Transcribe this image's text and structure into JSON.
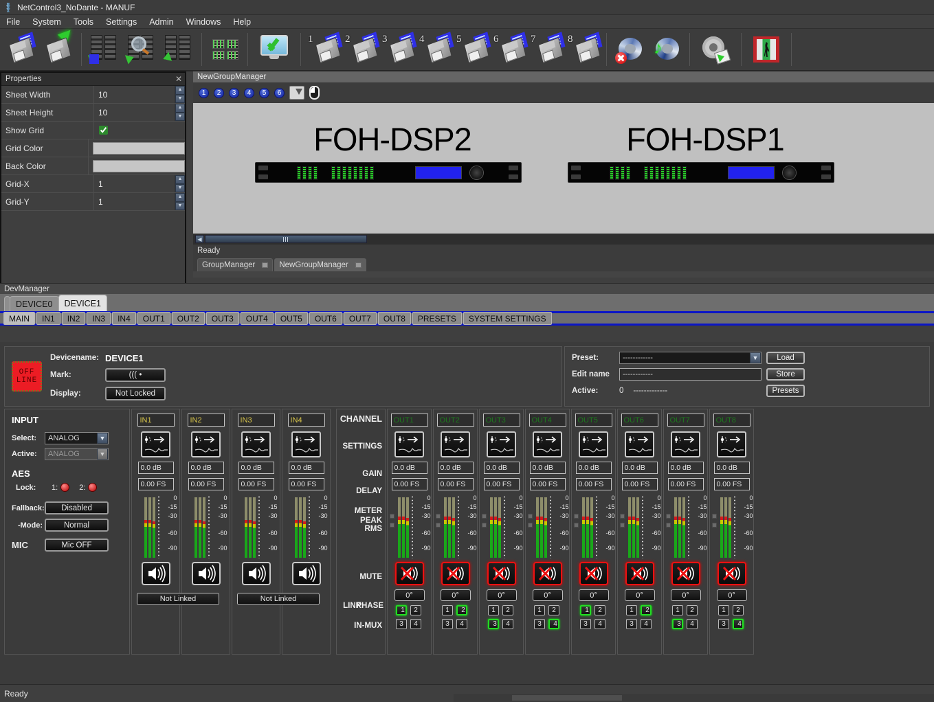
{
  "window": {
    "title": "NetControl3_NoDante - MANUF",
    "icon": "app-icon"
  },
  "menu": [
    "File",
    "System",
    "Tools",
    "Settings",
    "Admin",
    "Windows",
    "Help"
  ],
  "toolbar": {
    "groups": [
      [
        {
          "icon": "save-blue-icon",
          "label": ""
        },
        {
          "icon": "save-green-icon",
          "label": ""
        }
      ],
      [
        {
          "icon": "rack-download-icon",
          "label": ""
        },
        {
          "icon": "rack-scan-icon",
          "label": ""
        },
        {
          "icon": "rack-upload-icon",
          "label": ""
        }
      ],
      [
        {
          "icon": "matrix-icon",
          "label": ""
        },
        {
          "icon": "monitor-check-icon",
          "label": ""
        }
      ],
      [
        {
          "icon": "preset-save-icon",
          "label": "1"
        },
        {
          "icon": "preset-save-icon",
          "label": "2"
        },
        {
          "icon": "preset-save-icon",
          "label": "3"
        },
        {
          "icon": "preset-save-icon",
          "label": "4"
        },
        {
          "icon": "preset-save-icon",
          "label": "5"
        },
        {
          "icon": "preset-save-icon",
          "label": "6"
        },
        {
          "icon": "preset-save-icon",
          "label": "7"
        },
        {
          "icon": "preset-save-icon",
          "label": "8"
        }
      ],
      [
        {
          "icon": "mute-all-icon",
          "label": ""
        },
        {
          "icon": "tone-generator-icon",
          "label": ""
        }
      ],
      [
        {
          "icon": "settings-gear-icon",
          "label": ""
        }
      ],
      [
        {
          "icon": "exit-door-icon",
          "label": ""
        }
      ]
    ]
  },
  "properties": {
    "title": "Properties",
    "close_icon": "close-icon",
    "rows": [
      {
        "name": "Sheet Width",
        "value": "10",
        "type": "spin"
      },
      {
        "name": "Sheet Height",
        "value": "10",
        "type": "spin"
      },
      {
        "name": "Show Grid",
        "value": "",
        "type": "check",
        "checked": true
      },
      {
        "name": "Grid Color",
        "value": "",
        "type": "color",
        "color": "#c6c6c6"
      },
      {
        "name": "Back Color",
        "value": "",
        "type": "color",
        "color": "#c6c6c6"
      },
      {
        "name": "Grid-X",
        "value": "1",
        "type": "spin"
      },
      {
        "name": "Grid-Y",
        "value": "1",
        "type": "spin"
      }
    ]
  },
  "group_manager": {
    "title": "NewGroupManager",
    "group_buttons": [
      "1",
      "2",
      "3",
      "4",
      "5",
      "6"
    ],
    "hand_icon": "hand-tool-icon",
    "mouse_icon": "mouse-pointer-icon",
    "devices": [
      {
        "name": "FOH-DSP2"
      },
      {
        "name": "FOH-DSP1"
      }
    ],
    "status": "Ready",
    "tabs": [
      {
        "label": "GroupManager",
        "active": false
      },
      {
        "label": "NewGroupManager",
        "active": true
      }
    ]
  },
  "dev_manager": {
    "title": "DevManager",
    "device_tabs": [
      {
        "label": "DEVICE0",
        "active": false
      },
      {
        "label": "DEVICE1",
        "active": true
      }
    ],
    "sub_tabs": [
      {
        "label": "MAIN",
        "active": true
      },
      {
        "label": "IN1",
        "active": false
      },
      {
        "label": "IN2",
        "active": false
      },
      {
        "label": "IN3",
        "active": false
      },
      {
        "label": "IN4",
        "active": false
      },
      {
        "label": "OUT1",
        "active": false
      },
      {
        "label": "OUT2",
        "active": false
      },
      {
        "label": "OUT3",
        "active": false
      },
      {
        "label": "OUT4",
        "active": false
      },
      {
        "label": "OUT5",
        "active": false
      },
      {
        "label": "OUT6",
        "active": false
      },
      {
        "label": "OUT7",
        "active": false
      },
      {
        "label": "OUT8",
        "active": false
      },
      {
        "label": "PRESETS",
        "active": false
      },
      {
        "label": "SYSTEM SETTINGS",
        "active": false
      }
    ]
  },
  "device_info": {
    "status_badge": "OFF\nLINE",
    "status_line1": "OFF",
    "status_line2": "LINE",
    "devicename_label": "Devicename:",
    "devicename_value": "DEVICE1",
    "mark_label": "Mark:",
    "mark_value": "((( •",
    "display_label": "Display:",
    "display_value": "Not Locked"
  },
  "presets": {
    "preset_label": "Preset:",
    "preset_value": "------------",
    "load_label": "Load",
    "editname_label": "Edit name",
    "editname_value": "------------",
    "store_label": "Store",
    "active_label": "Active:",
    "active_number": "0",
    "active_value": "-------------",
    "presets_label": "Presets"
  },
  "input_section": {
    "title": "INPUT",
    "select_label": "Select:",
    "select_value": "ANALOG",
    "active_label": "Active:",
    "active_value": "ANALOG",
    "aes_title": "AES",
    "lock_label": "Lock:",
    "lock1_label": "1:",
    "lock2_label": "2:",
    "fallback_label": "Fallback:",
    "fallback_value": "Disabled",
    "mode_label": "-Mode:",
    "mode_value": "Normal",
    "mic_title": "MIC",
    "mic_value": "Mic OFF"
  },
  "channel_labels": {
    "channel": "CHANNEL",
    "settings": "SETTINGS",
    "gain": "GAIN",
    "delay": "DELAY",
    "meter": "METER",
    "peak": "PEAK",
    "rms": "RMS",
    "mute": "MUTE",
    "link": "LINK",
    "phase": "PHASE",
    "inmux": "IN-MUX"
  },
  "meter_scale": [
    "0",
    "-15",
    "-30",
    "-60",
    "-90"
  ],
  "inputs": [
    {
      "name": "IN1",
      "gain": "0.0 dB",
      "delay": "0.00 FS",
      "settings_icon": "eq-curve-icon",
      "speaker_icon": "speaker-icon",
      "meter_level": 62
    },
    {
      "name": "IN2",
      "gain": "0.0 dB",
      "delay": "0.00 FS",
      "settings_icon": "eq-curve-icon",
      "speaker_icon": "speaker-icon",
      "meter_level": 62
    },
    {
      "name": "IN3",
      "gain": "0.0 dB",
      "delay": "0.00 FS",
      "settings_icon": "eq-curve-icon",
      "speaker_icon": "speaker-icon",
      "meter_level": 62
    },
    {
      "name": "IN4",
      "gain": "0.0 dB",
      "delay": "0.00 FS",
      "settings_icon": "eq-curve-icon",
      "speaker_icon": "speaker-icon",
      "meter_level": 62
    }
  ],
  "input_links": [
    {
      "label": "Not Linked"
    },
    {
      "label": "Not Linked"
    }
  ],
  "outputs": [
    {
      "name": "OUT1",
      "gain": "0.0 dB",
      "delay": "0.00 FS",
      "muted": true,
      "phase": "0°",
      "mux": [
        1,
        2,
        3,
        4
      ],
      "mux_selected": 1,
      "meter_level": 68
    },
    {
      "name": "OUT2",
      "gain": "0.0 dB",
      "delay": "0.00 FS",
      "muted": true,
      "phase": "0°",
      "mux": [
        1,
        2,
        3,
        4
      ],
      "mux_selected": 2,
      "meter_level": 68
    },
    {
      "name": "OUT3",
      "gain": "0.0 dB",
      "delay": "0.00 FS",
      "muted": true,
      "phase": "0°",
      "mux": [
        1,
        2,
        3,
        4
      ],
      "mux_selected": 3,
      "meter_level": 68
    },
    {
      "name": "OUT4",
      "gain": "0.0 dB",
      "delay": "0.00 FS",
      "muted": true,
      "phase": "0°",
      "mux": [
        1,
        2,
        3,
        4
      ],
      "mux_selected": 4,
      "meter_level": 68
    },
    {
      "name": "OUT5",
      "gain": "0.0 dB",
      "delay": "0.00 FS",
      "muted": true,
      "phase": "0°",
      "mux": [
        1,
        2,
        3,
        4
      ],
      "mux_selected": 1,
      "meter_level": 68
    },
    {
      "name": "OUT6",
      "gain": "0.0 dB",
      "delay": "0.00 FS",
      "muted": true,
      "phase": "0°",
      "mux": [
        1,
        2,
        3,
        4
      ],
      "mux_selected": 2,
      "meter_level": 68
    },
    {
      "name": "OUT7",
      "gain": "0.0 dB",
      "delay": "0.00 FS",
      "muted": true,
      "phase": "0°",
      "mux": [
        1,
        2,
        3,
        4
      ],
      "mux_selected": 3,
      "meter_level": 68
    },
    {
      "name": "OUT8",
      "gain": "0.0 dB",
      "delay": "0.00 FS",
      "muted": true,
      "phase": "0°",
      "mux": [
        1,
        2,
        3,
        4
      ],
      "mux_selected": 4,
      "meter_level": 68
    }
  ],
  "status_bar": {
    "text": "Ready"
  },
  "colors": {
    "accent_blue": "#0b16c6",
    "offline_red": "#ec1c24",
    "mute_red": "#ee1111",
    "mux_green": "#22dd22",
    "in_label_yellow": "#d9c64a",
    "out_label_green": "#1d7a1d"
  }
}
